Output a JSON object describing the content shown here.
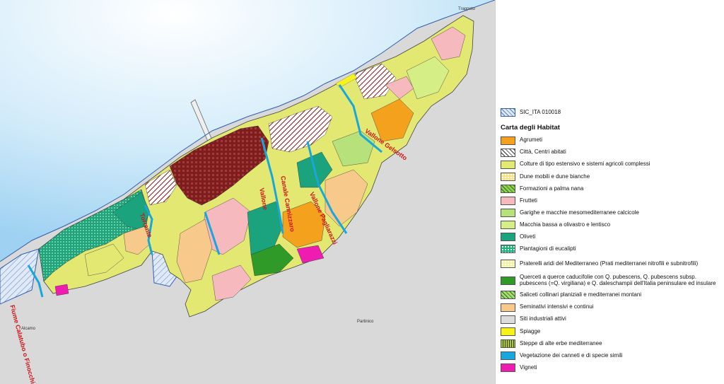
{
  "map": {
    "places": {
      "trappeto": "Trappeto",
      "alcamo": "Alcamo",
      "partinico": "Partinico"
    },
    "rivers": [
      "Fiume Calatubo o Finocchio",
      "Torrente",
      "Vallone",
      "Vallone Pagliarazzi",
      "Canale Cannizzaro",
      "Vallone Gelsotto"
    ]
  },
  "legend": {
    "sic": {
      "label": "SIC_ITA 010018",
      "color": "#b9d3f2"
    },
    "title": "Carta degli Habitat",
    "items": [
      {
        "label": "Agrumeti",
        "color": "#f4a21d",
        "pattern": "solid"
      },
      {
        "label": "Città, Centri abitati",
        "color": "#ffffff",
        "pattern": "hatch"
      },
      {
        "label": "Colture di tipo estensivo e sistemi agricoli complessi",
        "color": "#e2e872",
        "pattern": "solid"
      },
      {
        "label": "Dune mobili e dune bianche",
        "color": "#f6e38a",
        "pattern": "dots"
      },
      {
        "label": "Formazioni a palma nana",
        "color": "#8fd14f",
        "pattern": "stripes"
      },
      {
        "label": "Frutteti",
        "color": "#f6b9bd",
        "pattern": "solid"
      },
      {
        "label": "Garighe e macchie mesomediterranee calcicole",
        "color": "#b7e27b",
        "pattern": "solid"
      },
      {
        "label": "Macchia bassa a olivastro e lentisco",
        "color": "#d5ee86",
        "pattern": "solid"
      },
      {
        "label": "Oliveti",
        "color": "#1ba37e",
        "pattern": "solid"
      },
      {
        "label": "Piantagioni di eucalipti",
        "color": "#21b07d",
        "pattern": "dots"
      },
      {
        "label": "Praterelli aridi del Mediterraneo (Prati mediterranei nitrofili e subnitrofili)",
        "color": "#f2f3a6",
        "pattern": "dots"
      },
      {
        "label": "Querceti a querce caducifolie con Q. pubescens, Q. pubescens subsp. pubescens (=Q. virgiliana) e Q. daleschampii dell'Italia peninsulare ed insulare",
        "color": "#2f9a28",
        "pattern": "solid"
      },
      {
        "label": "Saliceti collinari planiziali e mediterranei montani",
        "color": "#a6dc73",
        "pattern": "stripes"
      },
      {
        "label": "Seminativi intensivi e continui",
        "color": "#f7c98b",
        "pattern": "solid"
      },
      {
        "label": "Siti industriali attivi",
        "color": "#dcdcdc",
        "pattern": "solid"
      },
      {
        "label": "Spiagge",
        "color": "#f7f21a",
        "pattern": "solid"
      },
      {
        "label": "Steppe di alte erbe mediterranee",
        "color": "#b5c23a",
        "pattern": "vstripes"
      },
      {
        "label": "Vegetazione dei canneti e di specie simili",
        "color": "#18a7dc",
        "pattern": "solid"
      },
      {
        "label": "Vigneti",
        "color": "#ee1cb0",
        "pattern": "solid"
      }
    ]
  }
}
